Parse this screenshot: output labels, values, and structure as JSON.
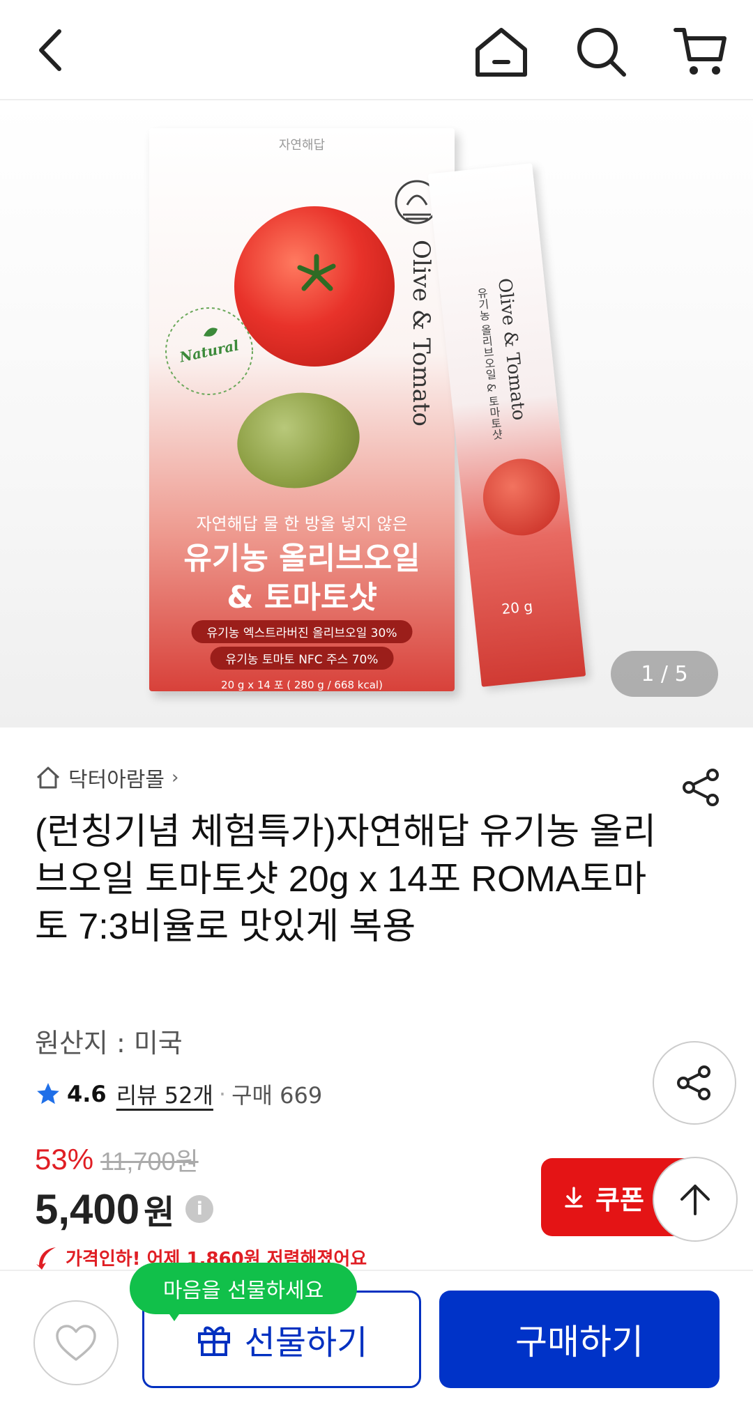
{
  "header": {
    "back_icon": "chevron-left-icon",
    "home_icon": "home-icon",
    "search_icon": "search-icon",
    "cart_icon": "cart-icon"
  },
  "gallery": {
    "pager": "1 / 5",
    "current": 1,
    "total": 5
  },
  "product": {
    "store_name": "닥터아람몰",
    "title": "(런칭기념 체험특가)자연해답 유기농 올리브오일  토마토샷 20g x 14포 ROMA토마토 7:3비율로 맛있게 복용",
    "origin": "원산지 : 미국",
    "rating": "4.6",
    "review_label": "리뷰 52개",
    "purchase_label": "구매 669",
    "discount_rate": "53%",
    "original_price": "11,700원",
    "price": "5,400",
    "price_unit": "원",
    "coupon_label": "쿠폰",
    "price_drop_note": "가격인하! 어제 1,860원 저렴해졌어요"
  },
  "bottom_bar": {
    "tooltip": "마음을 선물하세요",
    "gift_label": "선물하기",
    "buy_label": "구매하기"
  },
  "colors": {
    "accent_red": "#e41415",
    "primary_blue": "#0033c8",
    "tooltip_green": "#11c04a",
    "star_blue": "#1f6fe8"
  }
}
